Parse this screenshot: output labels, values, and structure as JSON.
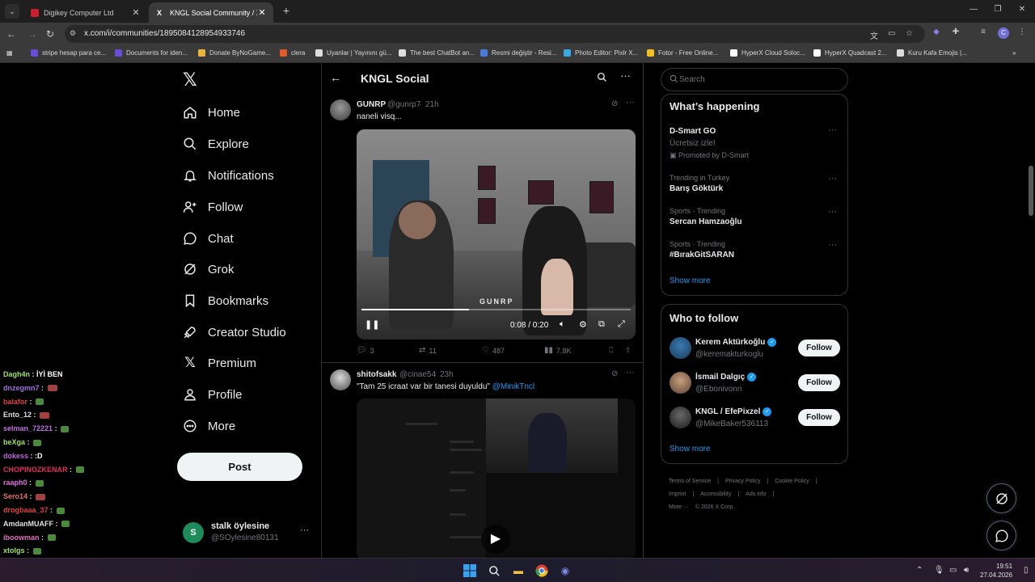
{
  "browser": {
    "tabs": [
      {
        "title": "Digikey Computer Ltd",
        "active": false,
        "favicon_color": "#cc1e2c"
      },
      {
        "title": "KNGL Social Community / X",
        "active": true,
        "favicon_color": "#ffffff"
      }
    ],
    "url": "x.com/i/communities/1895084128954933746",
    "bookmarks": [
      {
        "label": "stripe hesap para ce...",
        "color": "#6a4cdb"
      },
      {
        "label": "Documents for iden...",
        "color": "#6a4cdb"
      },
      {
        "label": "Donate ByNoGame...",
        "color": "#e8b43a"
      },
      {
        "label": "clera",
        "color": "#e05a2a"
      },
      {
        "label": "Uyanlar | Yayınını gü...",
        "color": "#dddddd"
      },
      {
        "label": "The best ChatBot an...",
        "color": "#dddddd"
      },
      {
        "label": "Resmi değiştir - Resi...",
        "color": "#4a7ad8"
      },
      {
        "label": "Photo Editor: Pixlr X...",
        "color": "#3aa8e0"
      },
      {
        "label": "Fotor - Free Online...",
        "color": "#f0c020"
      },
      {
        "label": "HyperX Cloud Soloc...",
        "color": "#ffffff"
      },
      {
        "label": "HyperX Quadcast 2...",
        "color": "#ffffff"
      },
      {
        "label": "Kuru Kafa Emojis |...",
        "color": "#dddddd"
      }
    ],
    "profile_initial": "C"
  },
  "chat_overlay": [
    {
      "user": "Dagh4n",
      "color": "#a0e060",
      "msg": "İYİ BEN",
      "emote": ""
    },
    {
      "user": "dnzegmn7",
      "color": "#a070e0",
      "msg": "",
      "emote": "red"
    },
    {
      "user": "balafor",
      "color": "#e04040",
      "msg": "",
      "emote": "green"
    },
    {
      "user": "Ento_12",
      "color": "#e0e0e0",
      "msg": "",
      "emote": "red"
    },
    {
      "user": "selman_72221",
      "color": "#c070e0",
      "msg": "",
      "emote": "green"
    },
    {
      "user": "beXga",
      "color": "#a0e060",
      "msg": "",
      "emote": "green"
    },
    {
      "user": "dokess",
      "color": "#c060e0",
      "msg": ":D",
      "emote": ""
    },
    {
      "user": "CHOPINOZKENAR",
      "color": "#e03060",
      "msg": "",
      "emote": "green"
    },
    {
      "user": "raaph0",
      "color": "#e070e0",
      "msg": "",
      "emote": "green"
    },
    {
      "user": "Sero14",
      "color": "#e07070",
      "msg": "",
      "emote": "red"
    },
    {
      "user": "drogbaaa_37",
      "color": "#e04040",
      "msg": "",
      "emote": "green"
    },
    {
      "user": "AmdanMUAFF",
      "color": "#e0e0e0",
      "msg": "",
      "emote": "green"
    },
    {
      "user": "iboowman",
      "color": "#e070c0",
      "msg": "",
      "emote": "green"
    },
    {
      "user": "xtolgs",
      "color": "#a0e060",
      "msg": "",
      "emote": "green"
    }
  ],
  "nav": {
    "items": [
      {
        "label": "Home",
        "icon": "home-icon"
      },
      {
        "label": "Explore",
        "icon": "search-icon"
      },
      {
        "label": "Notifications",
        "icon": "bell-icon"
      },
      {
        "label": "Follow",
        "icon": "person-add-icon"
      },
      {
        "label": "Chat",
        "icon": "chat-icon"
      },
      {
        "label": "Grok",
        "icon": "grok-icon"
      },
      {
        "label": "Bookmarks",
        "icon": "bookmark-icon"
      },
      {
        "label": "Creator Studio",
        "icon": "rocket-icon"
      },
      {
        "label": "Premium",
        "icon": "x-logo-icon"
      },
      {
        "label": "Profile",
        "icon": "person-icon"
      },
      {
        "label": "More",
        "icon": "more-circle-icon"
      }
    ],
    "post_label": "Post",
    "account": {
      "initial": "S",
      "name": "stalk öylesine",
      "handle": "@SOylesine80131",
      "more": "···"
    }
  },
  "timeline": {
    "title": "KNGL Social",
    "tweets": [
      {
        "name": "GUNRP",
        "handle": "@gunrp7",
        "time": "21h",
        "text": "naneli visq...",
        "watermark": "GUNRP",
        "video_time": "0:08 / 0:20",
        "video_progress": 0.4,
        "replies": "3",
        "retweets": "11",
        "likes": "487",
        "views": "7.8K"
      },
      {
        "name": "shitofsakk",
        "handle": "@cinae54",
        "time": "23h",
        "text": "\"Tam 25 icraat var bir tanesi duyuldu\"",
        "mention": "@MinikTncl"
      }
    ]
  },
  "sidebar": {
    "search_placeholder": "Search",
    "happening_title": "What’s happening",
    "trends": [
      {
        "meta": "",
        "name": "D-Smart GO",
        "sub": "Ücretsiz izle!",
        "promoted": "Promoted by D-Smart"
      },
      {
        "meta": "Trending in Turkey",
        "name": "Barış Göktürk"
      },
      {
        "meta": "Sports · Trending",
        "name": "Sercan Hamzaoğlu"
      },
      {
        "meta": "Sports · Trending",
        "name": "#BırakGitSARAN"
      }
    ],
    "show_more": "Show more",
    "who_to_follow_title": "Who to follow",
    "who_to_follow": [
      {
        "name": "Kerem Aktürkoğlu",
        "handle": "@keremakturkoglu",
        "verified": true,
        "avatar_color": "#2a5a8a"
      },
      {
        "name": "İsmail Dalgıç",
        "handle": "@Ebonivonn",
        "verified": true,
        "avatar_color": "#6a5040"
      },
      {
        "name": "KNGL / EfePixzel",
        "handle": "@MikeBaker536113",
        "verified": true,
        "avatar_color": "#2a2a2a"
      }
    ],
    "follow_label": "Follow",
    "footer": [
      "Terms of Service",
      "|",
      "Privacy Policy",
      "|",
      "Cookie Policy",
      "|",
      "Imprint",
      "|",
      "Accessibility",
      "|",
      "Ads info",
      "|",
      "More ···",
      "© 2026 X Corp."
    ]
  },
  "taskbar": {
    "time": "19:51",
    "date": "27.04.2026"
  }
}
